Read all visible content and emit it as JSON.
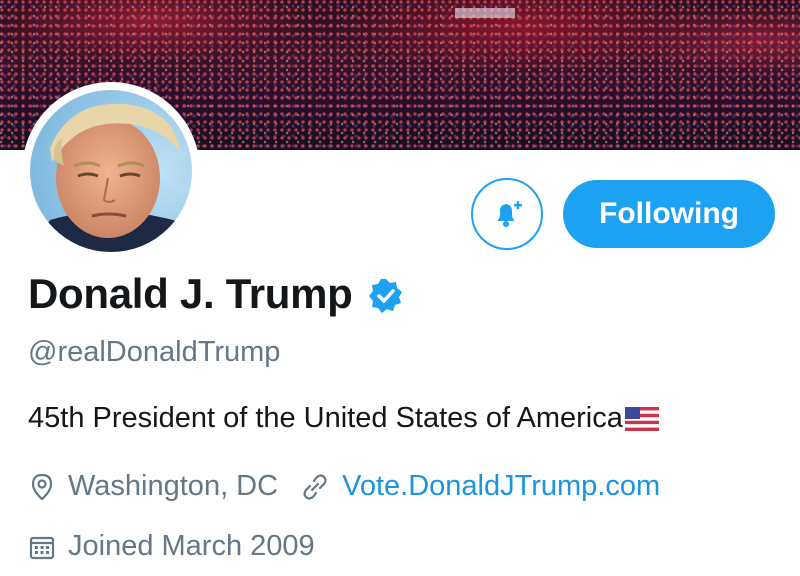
{
  "profile": {
    "name": "Donald J. Trump",
    "handle": "@realDonaldTrump",
    "bio": "45th President of the United States of America",
    "bio_emoji": "us-flag",
    "location": "Washington, DC",
    "website": "Vote.DonaldJTrump.com",
    "joined": "Joined March 2009",
    "verified": true
  },
  "actions": {
    "notify_icon": "bell-plus-icon",
    "following_label": "Following"
  },
  "icons": {
    "location": "map-pin-icon",
    "website": "link-icon",
    "joined": "calendar-icon",
    "verified": "verified-badge-icon"
  },
  "colors": {
    "accent": "#1da1f2",
    "link": "#1b95e0",
    "text_primary": "#14171a",
    "text_secondary": "#657786"
  }
}
